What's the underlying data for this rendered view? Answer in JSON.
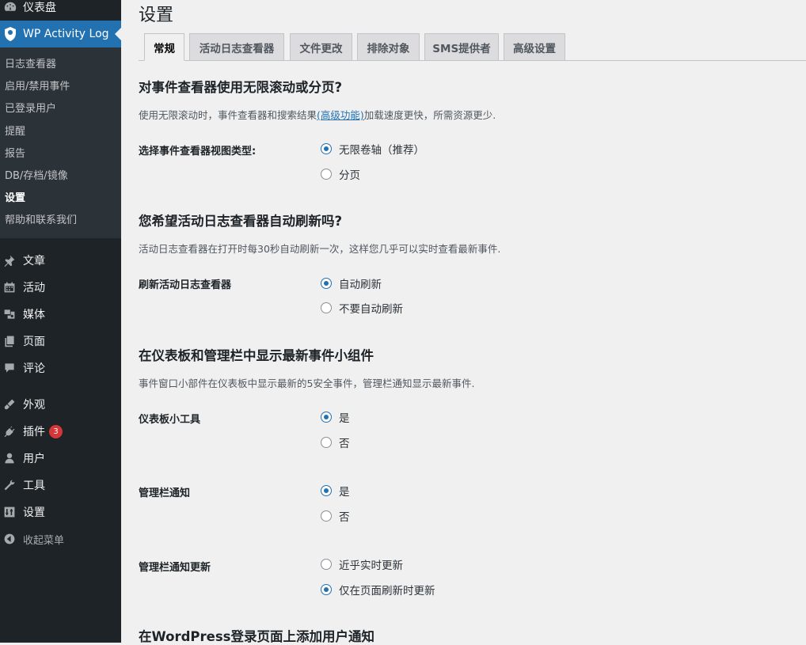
{
  "sidebar": {
    "dashboard": "仪表盘",
    "plugin": "WP Activity Log",
    "submenu": [
      "日志查看器",
      "启用/禁用事件",
      "已登录用户",
      "提醒",
      "报告",
      "DB/存档/镜像",
      "设置",
      "帮助和联系我们"
    ],
    "menu": [
      {
        "label": "文章",
        "icon": "pin-icon"
      },
      {
        "label": "活动",
        "icon": "calendar-icon"
      },
      {
        "label": "媒体",
        "icon": "media-icon"
      },
      {
        "label": "页面",
        "icon": "page-icon"
      },
      {
        "label": "评论",
        "icon": "comment-icon"
      },
      {
        "label": "外观",
        "icon": "brush-icon"
      },
      {
        "label": "插件",
        "icon": "plug-icon",
        "badge": "3"
      },
      {
        "label": "用户",
        "icon": "user-icon"
      },
      {
        "label": "工具",
        "icon": "wrench-icon"
      },
      {
        "label": "设置",
        "icon": "settings-icon"
      }
    ],
    "collapse": "收起菜单"
  },
  "page": {
    "title": "设置",
    "tabs": [
      "常规",
      "活动日志查看器",
      "文件更改",
      "排除对象",
      "SMS提供者",
      "高级设置"
    ]
  },
  "sections": {
    "s1": {
      "heading": "对事件查看器使用无限滚动或分页?",
      "desc_before": "使用无限滚动时，事件查看器和搜索结果",
      "desc_link": "(高级功能)",
      "desc_after": "加载速度更快，所需资源更少.",
      "label": "选择事件查看器视图类型:",
      "opt1": "无限卷轴（推荐）",
      "opt2": "分页"
    },
    "s2": {
      "heading": "您希望活动日志查看器自动刷新吗?",
      "desc": "活动日志查看器在打开时每30秒自动刷新一次，这样您几乎可以实时查看最新事件.",
      "label": "刷新活动日志查看器",
      "opt1": "自动刷新",
      "opt2": "不要自动刷新"
    },
    "s3": {
      "heading": "在仪表板和管理栏中显示最新事件小组件",
      "desc": "事件窗口小部件在仪表板中显示最新的5安全事件，管理栏通知显示最新事件.",
      "label1": "仪表板小工具",
      "label2": "管理栏通知",
      "label3": "管理栏通知更新",
      "yes": "是",
      "no": "否",
      "realtime": "近乎实时更新",
      "onrefresh": "仅在页面刷新时更新"
    },
    "s4": {
      "heading": "在WordPress登录页面上添加用户通知"
    }
  }
}
